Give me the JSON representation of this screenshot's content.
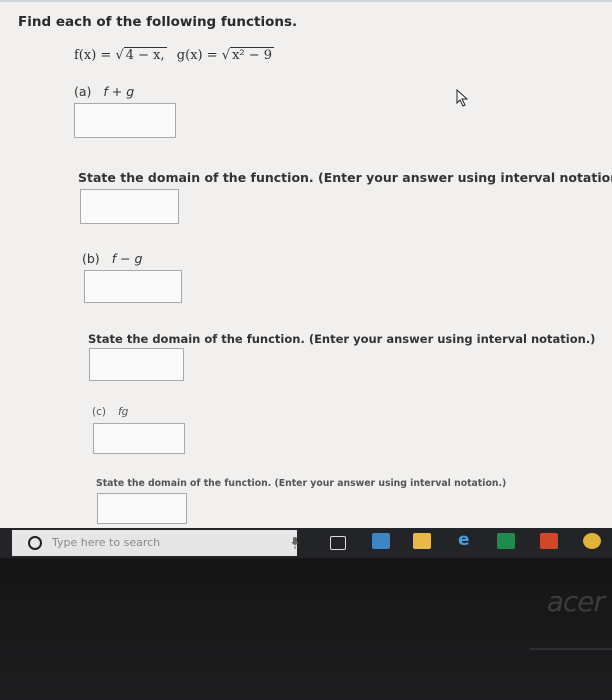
{
  "header": {
    "title": "Find each of the following functions."
  },
  "functions": {
    "f_lhs": "f(x) = ",
    "f_radicand": "4 − x,",
    "g_lhs": "g(x) = ",
    "g_radicand": "x² − 9"
  },
  "parts": [
    {
      "label": "(a)",
      "expr": "f + g",
      "domain_prompt": "State the domain of the function. (Enter your answer using interval notation.)"
    },
    {
      "label": "(b)",
      "expr": "f − g",
      "domain_prompt": "State the domain of the function. (Enter your answer using interval notation.)"
    },
    {
      "label": "(c)",
      "expr": "fg",
      "domain_prompt": "State the domain of the function. (Enter your answer using interval notation.)"
    }
  ],
  "taskbar": {
    "search_placeholder": "Type here to search",
    "icons": [
      "search-circle-icon",
      "microphone-icon",
      "task-view-icon",
      "store-icon",
      "file-explorer-icon",
      "edge-icon",
      "excel-icon",
      "powerpoint-icon",
      "chrome-icon"
    ]
  },
  "bezel": {
    "brand": "acer"
  }
}
